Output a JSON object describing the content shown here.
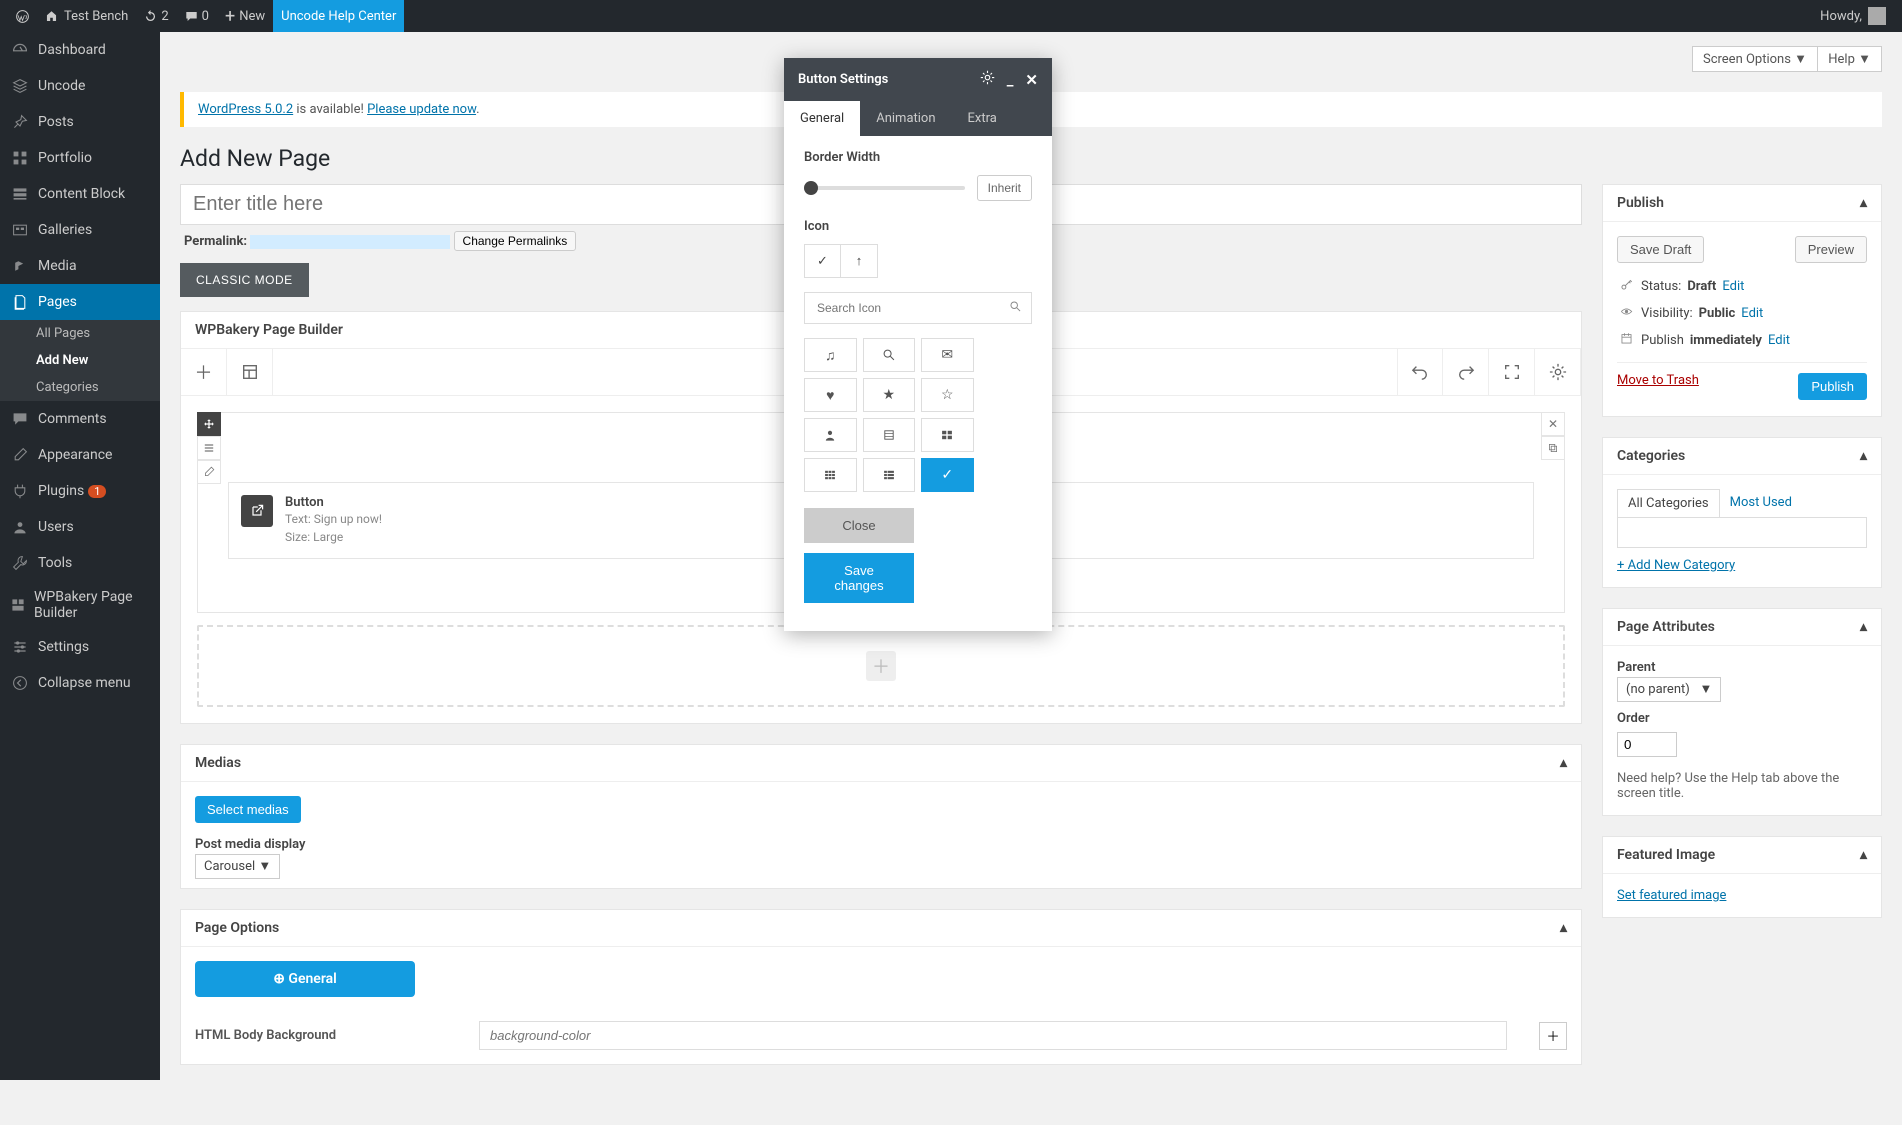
{
  "adminbar": {
    "site": "Test Bench",
    "updates": "2",
    "comments": "0",
    "new": "New",
    "help_center": "Uncode Help Center",
    "howdy": "Howdy,"
  },
  "sidebar": {
    "items": [
      {
        "label": "Dashboard"
      },
      {
        "label": "Uncode"
      },
      {
        "label": "Posts"
      },
      {
        "label": "Portfolio"
      },
      {
        "label": "Content Block"
      },
      {
        "label": "Galleries"
      },
      {
        "label": "Media"
      },
      {
        "label": "Pages",
        "current": true,
        "sub": [
          {
            "label": "All Pages"
          },
          {
            "label": "Add New",
            "current": true
          },
          {
            "label": "Categories"
          }
        ]
      },
      {
        "label": "Comments"
      },
      {
        "label": "Appearance"
      },
      {
        "label": "Plugins",
        "badge": "1"
      },
      {
        "label": "Users"
      },
      {
        "label": "Tools"
      },
      {
        "label": "WPBakery Page Builder"
      },
      {
        "label": "Settings"
      },
      {
        "label": "Collapse menu"
      }
    ]
  },
  "top": {
    "screen_options": "Screen Options",
    "help": "Help"
  },
  "notice": {
    "pre": "WordPress 5.0.2",
    "mid": " is available! ",
    "link": "Please update now"
  },
  "page": {
    "title": "Add New Page",
    "title_placeholder": "Enter title here",
    "permalink_label": "Permalink:",
    "change_permalinks": "Change Permalinks",
    "classic_mode": "CLASSIC MODE"
  },
  "wpbakery": {
    "heading": "WPBakery Page Builder",
    "element": {
      "name": "Button",
      "text": "Text: Sign up now!",
      "size": "Size: Large"
    }
  },
  "medias": {
    "heading": "Medias",
    "select": "Select medias",
    "display_label": "Post media display",
    "display_value": "Carousel"
  },
  "page_options": {
    "heading": "Page Options",
    "general_tab": "General",
    "html_body_bg": "HTML Body Background",
    "bg_placeholder": "background-color"
  },
  "publish": {
    "heading": "Publish",
    "save_draft": "Save Draft",
    "preview": "Preview",
    "status_label": "Status:",
    "status_value": "Draft",
    "visibility_label": "Visibility:",
    "visibility_value": "Public",
    "publish_label": "Publish",
    "publish_value": "immediately",
    "edit": "Edit",
    "trash": "Move to Trash",
    "publish_btn": "Publish"
  },
  "categories": {
    "heading": "Categories",
    "all": "All Categories",
    "most_used": "Most Used",
    "add_new": "+ Add New Category"
  },
  "attributes": {
    "heading": "Page Attributes",
    "parent_label": "Parent",
    "parent_value": "(no parent)",
    "order_label": "Order",
    "order_value": "0",
    "help_text": "Need help? Use the Help tab above the screen title."
  },
  "featured": {
    "heading": "Featured Image",
    "set": "Set featured image"
  },
  "modal": {
    "title": "Button Settings",
    "tabs": {
      "general": "General",
      "animation": "Animation",
      "extra": "Extra"
    },
    "border_width_label": "Border Width",
    "inherit": "Inherit",
    "icon_label": "Icon",
    "search_placeholder": "Search Icon",
    "close": "Close",
    "save": "Save changes"
  }
}
